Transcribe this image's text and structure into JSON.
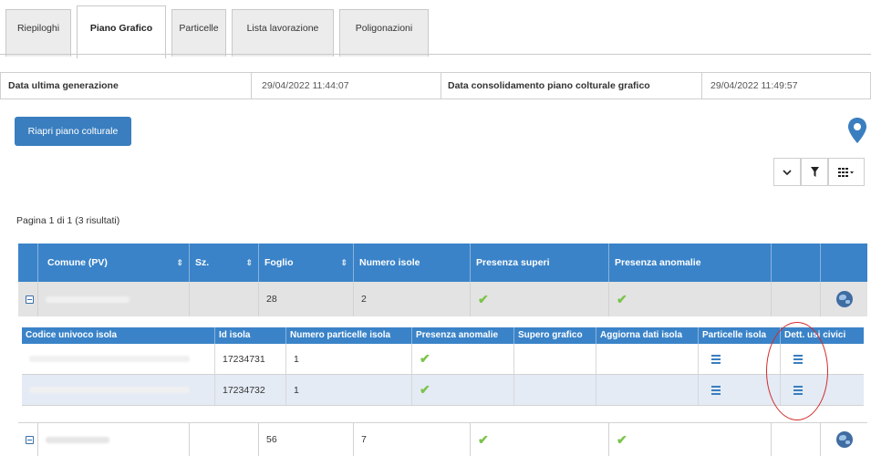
{
  "tabs": [
    {
      "label": "Riepiloghi",
      "active": false
    },
    {
      "label": "Piano Grafico",
      "active": true
    },
    {
      "label": "Particelle",
      "active": false
    },
    {
      "label": "Lista lavorazione",
      "active": false
    },
    {
      "label": "Poligonazioni",
      "active": false
    }
  ],
  "info": {
    "last_generation_label": "Data ultima generazione",
    "last_generation_value": "29/04/2022 11:44:07",
    "consolidation_label": "Data consolidamento piano colturale grafico",
    "consolidation_value": "29/04/2022 11:49:57"
  },
  "actions": {
    "reopen_label": "Riapri piano colturale"
  },
  "pager": {
    "text": "Pagina 1 di 1 (3 risultati)"
  },
  "table": {
    "headers": [
      "Comune (PV)",
      "Sz.",
      "Foglio",
      "Numero isole",
      "Presenza superi",
      "Presenza anomalie"
    ],
    "rows": [
      {
        "foglio": "28",
        "numero_isole": "2"
      },
      {
        "foglio": "56",
        "numero_isole": "7"
      }
    ]
  },
  "nested": {
    "headers": [
      "Codice univoco isola",
      "Id isola",
      "Numero particelle isola",
      "Presenza anomalie",
      "Supero grafico",
      "Aggiorna dati isola",
      "Particelle isola",
      "Dett. usi civici"
    ],
    "rows": [
      {
        "id_isola": "17234731",
        "numero_particelle": "1"
      },
      {
        "id_isola": "17234732",
        "numero_particelle": "1"
      }
    ]
  },
  "icons": {
    "check": "✔",
    "pin": "map-pin-icon",
    "globe": "globe-icon",
    "list": "list-icon",
    "chevron": "chevron-down-icon",
    "filter": "filter-icon",
    "columns": "columns-icon"
  },
  "colors": {
    "primary": "#3a83c8",
    "check": "#7bc44a",
    "annotation": "#d12a2a"
  }
}
